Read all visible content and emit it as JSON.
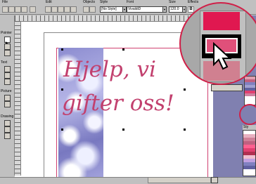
{
  "menubar": {
    "file": "File",
    "edit": "Edit",
    "objects": "Objects",
    "style": "Style",
    "font": "Font",
    "size": "Size",
    "effects": "Effects"
  },
  "toolbar": {
    "style_value": "[No Style]",
    "font_value": "VivaldiD",
    "size_value": "120.0",
    "bold_label": "B"
  },
  "tools_panel": {
    "pointer_label": "Pointer",
    "text_label": "Text",
    "picture_label": "Picture",
    "drawing_label": "Drawing"
  },
  "document": {
    "text_line1": "Hjelp, vi",
    "text_line2": "gifter oss!"
  },
  "colors": {
    "accent": "#d02048",
    "text_magenta": "#c2406e",
    "swatch_list": [
      "#ffffff",
      "#e8b0c0",
      "#d08098",
      "#c06080",
      "#ff6090",
      "#e04070",
      "#b03050",
      "#f0c0d0",
      "#c0a0e0",
      "#8080c0",
      "#6060a0"
    ]
  },
  "style_panel": {
    "label": "Sty"
  }
}
